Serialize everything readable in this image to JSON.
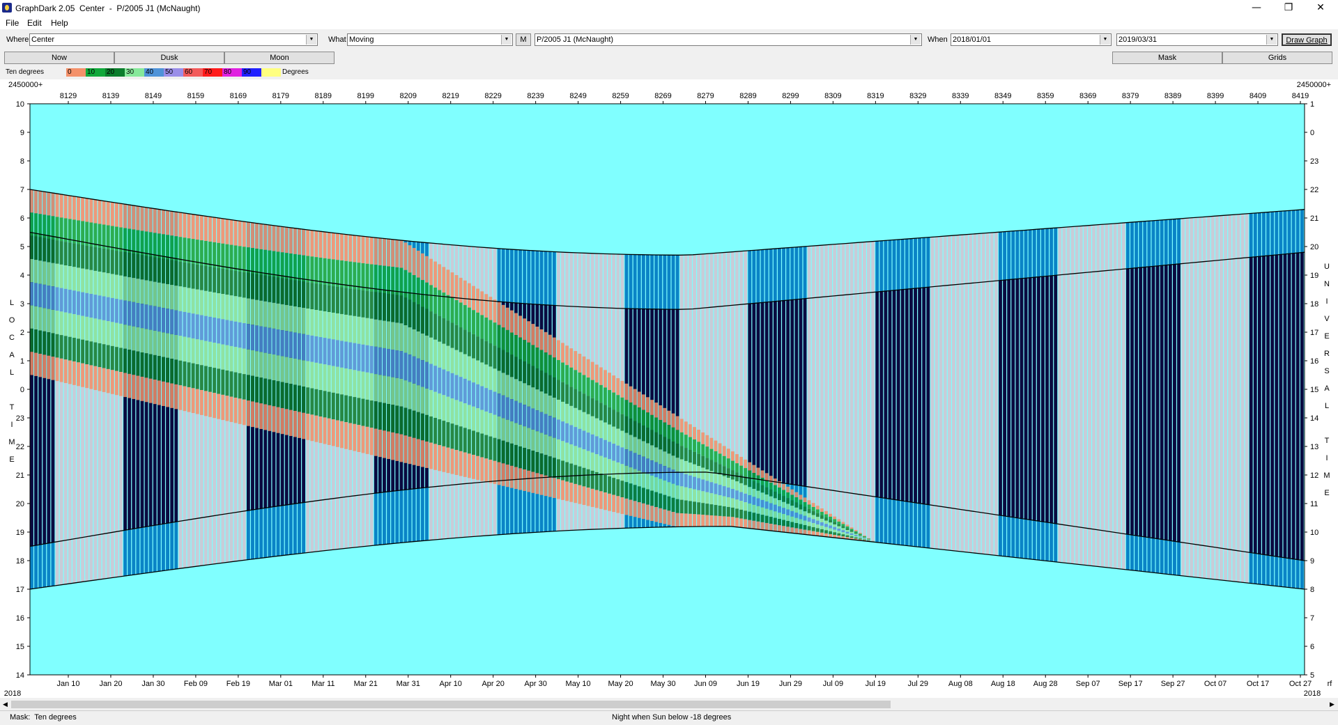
{
  "window": {
    "title": "GraphDark 2.05  Center  -  P/2005 J1 (McNaught)",
    "minimize_glyph": "—",
    "restore_glyph": "❐",
    "close_glyph": "✕"
  },
  "menu": {
    "items": [
      "File",
      "Edit",
      "Help"
    ]
  },
  "toolbar": {
    "where_label": "Where",
    "where_value": "Center",
    "what_label": "What",
    "what_value": "Moving",
    "m_button": "M",
    "object_value": "P/2005 J1 (McNaught)",
    "when_label": "When",
    "start_date": "2018/01/01",
    "end_date": "2019/03/31",
    "draw_button": "Draw Graph"
  },
  "buttons": {
    "now": "Now",
    "dusk": "Dusk",
    "moon": "Moon",
    "mask": "Mask",
    "grids": "Grids"
  },
  "legend": {
    "mode": "Ten degrees",
    "unit": "Degrees",
    "swatches": [
      {
        "label": "0",
        "color": "#f4916a"
      },
      {
        "label": "10",
        "color": "#11a83a"
      },
      {
        "label": "20",
        "color": "#0b7d2c"
      },
      {
        "label": "30",
        "color": "#86e89a"
      },
      {
        "label": "40",
        "color": "#4f93d8"
      },
      {
        "label": "50",
        "color": "#9a8ee8"
      },
      {
        "label": "60",
        "color": "#f25a5a"
      },
      {
        "label": "70",
        "color": "#ff1a1a"
      },
      {
        "label": "80",
        "color": "#e020e0"
      },
      {
        "label": "90",
        "color": "#2020ff"
      },
      {
        "label": "",
        "color": "#ffff80"
      }
    ]
  },
  "graph": {
    "jd_base": "2450000+",
    "year_left": "2018",
    "year_right": "2018",
    "corner_label": "rf",
    "jd_ticks": [
      "8129",
      "8139",
      "8149",
      "8159",
      "8169",
      "8179",
      "8189",
      "8199",
      "8209",
      "8219",
      "8229",
      "8239",
      "8249",
      "8259",
      "8269",
      "8279",
      "8289",
      "8299",
      "8309",
      "8319",
      "8329",
      "8339",
      "8349",
      "8359",
      "8369",
      "8379",
      "8389",
      "8399",
      "8409",
      "8419"
    ],
    "date_ticks": [
      "Jan 10",
      "Jan 20",
      "Jan 30",
      "Feb 09",
      "Feb 19",
      "Mar 01",
      "Mar 11",
      "Mar 21",
      "Mar 31",
      "Apr 10",
      "Apr 20",
      "Apr 30",
      "May 10",
      "May 20",
      "May 30",
      "Jun 09",
      "Jun 19",
      "Jun 29",
      "Jul 09",
      "Jul 19",
      "Jul 29",
      "Aug 08",
      "Aug 18",
      "Aug 28",
      "Sep 07",
      "Sep 17",
      "Sep 27",
      "Oct 07",
      "Oct 17",
      "Oct 27"
    ],
    "left_hours": [
      "10",
      "9",
      "8",
      "7",
      "6",
      "5",
      "4",
      "3",
      "2",
      "1",
      "0",
      "23",
      "22",
      "21",
      "20",
      "19",
      "18",
      "17",
      "16",
      "15",
      "14"
    ],
    "right_hours": [
      "1",
      "0",
      "23",
      "22",
      "21",
      "20",
      "19",
      "18",
      "17",
      "16",
      "15",
      "14",
      "13",
      "12",
      "11",
      "10",
      "9",
      "8",
      "7",
      "6",
      "5"
    ],
    "left_axis_title": [
      "L",
      "O",
      "C",
      "A",
      "L",
      "",
      "T",
      "I",
      "M",
      "E"
    ],
    "right_axis_title": [
      "U",
      "N",
      "I",
      "V",
      "E",
      "R",
      "S",
      "A",
      "L",
      "",
      "T",
      "I",
      "M",
      "E"
    ],
    "colors": {
      "background": "#80ffff",
      "night": "#0a0a40",
      "twilight": "#0a84c6",
      "moonlight": "#c8ccd8"
    }
  },
  "status": {
    "left": "Mask:  Ten degrees",
    "center": "Night when Sun below -18 degrees"
  }
}
